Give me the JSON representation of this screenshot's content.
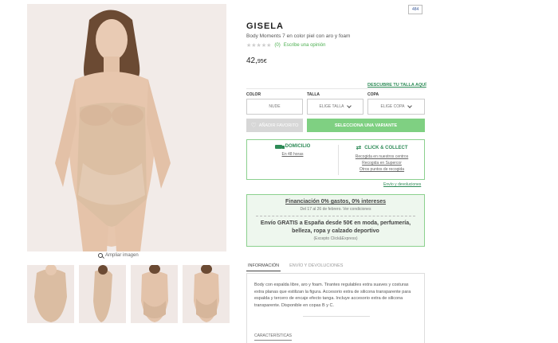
{
  "gallery": {
    "zoom_label": "Ampliar imagen",
    "thumbnails": [
      "front-view",
      "side-view",
      "back-view",
      "back-view-2"
    ]
  },
  "product": {
    "ref_badge": "484",
    "name": "GISELA",
    "subtitle": "Body Moments 7 en color piel con aro y foam",
    "rating_stars": "★★★★★",
    "rating_value": 0,
    "review_count": "(0)",
    "write_review": "Escribe una opinión",
    "price_int": "42,",
    "price_dec": "95€"
  },
  "size_guide_link": "DESCUBRE TU TALLA AQUÍ",
  "selectors": {
    "color_label": "COLOR",
    "color_value": "NUDE",
    "talla_label": "TALLA",
    "talla_value": "ELIGE TALLA",
    "copa_label": "COPA",
    "copa_value": "ELIGE COPA"
  },
  "actions": {
    "favorite_label": "AÑADIR FAVORITO",
    "variant_label": "SELECCIONA UNA VARIANTE"
  },
  "delivery": {
    "home_title": "DOMICILIO",
    "home_time": "En 48 horas",
    "collect_title": "CLICK & COLLECT",
    "collect_links": [
      "Recogida en nuestros centros",
      "Recogida en Supercor",
      "Otros puntos de recogida"
    ],
    "returns_link": "Envío y devoluciones"
  },
  "promo": {
    "financing": "Financiación 0% gastos, 0% intereses",
    "financing_dates": "Del 17 al 26 de febrero. Ver condiciones",
    "shipping_line1": "Envío GRATIS a España desde 50€ en moda, perfumería,",
    "shipping_line2": "belleza, ropa y calzado deportivo",
    "shipping_note": "(Excepto Click&Express)"
  },
  "tabs": [
    {
      "label": "INFORMACIÓN",
      "active": true
    },
    {
      "label": "ENVÍO Y DEVOLUCIONES",
      "active": false
    }
  ],
  "description": "Body con espalda libre, aro y foam. Tirantes regulables extra suaves y costuras extra planas que estilizan la figura. Accesorio extra de silicona transparente para espalda y tercero de encaje efecto tanga. Incluye accesorio extra de silicona transparente. Disponible en copas B y C.",
  "characteristics_label": "CARACTERÍSTICAS",
  "colors": {
    "accent_green": "#2e8b57",
    "button_green": "#7fd082",
    "promo_bg": "#eef7ee",
    "skin": "#d7b89b"
  }
}
